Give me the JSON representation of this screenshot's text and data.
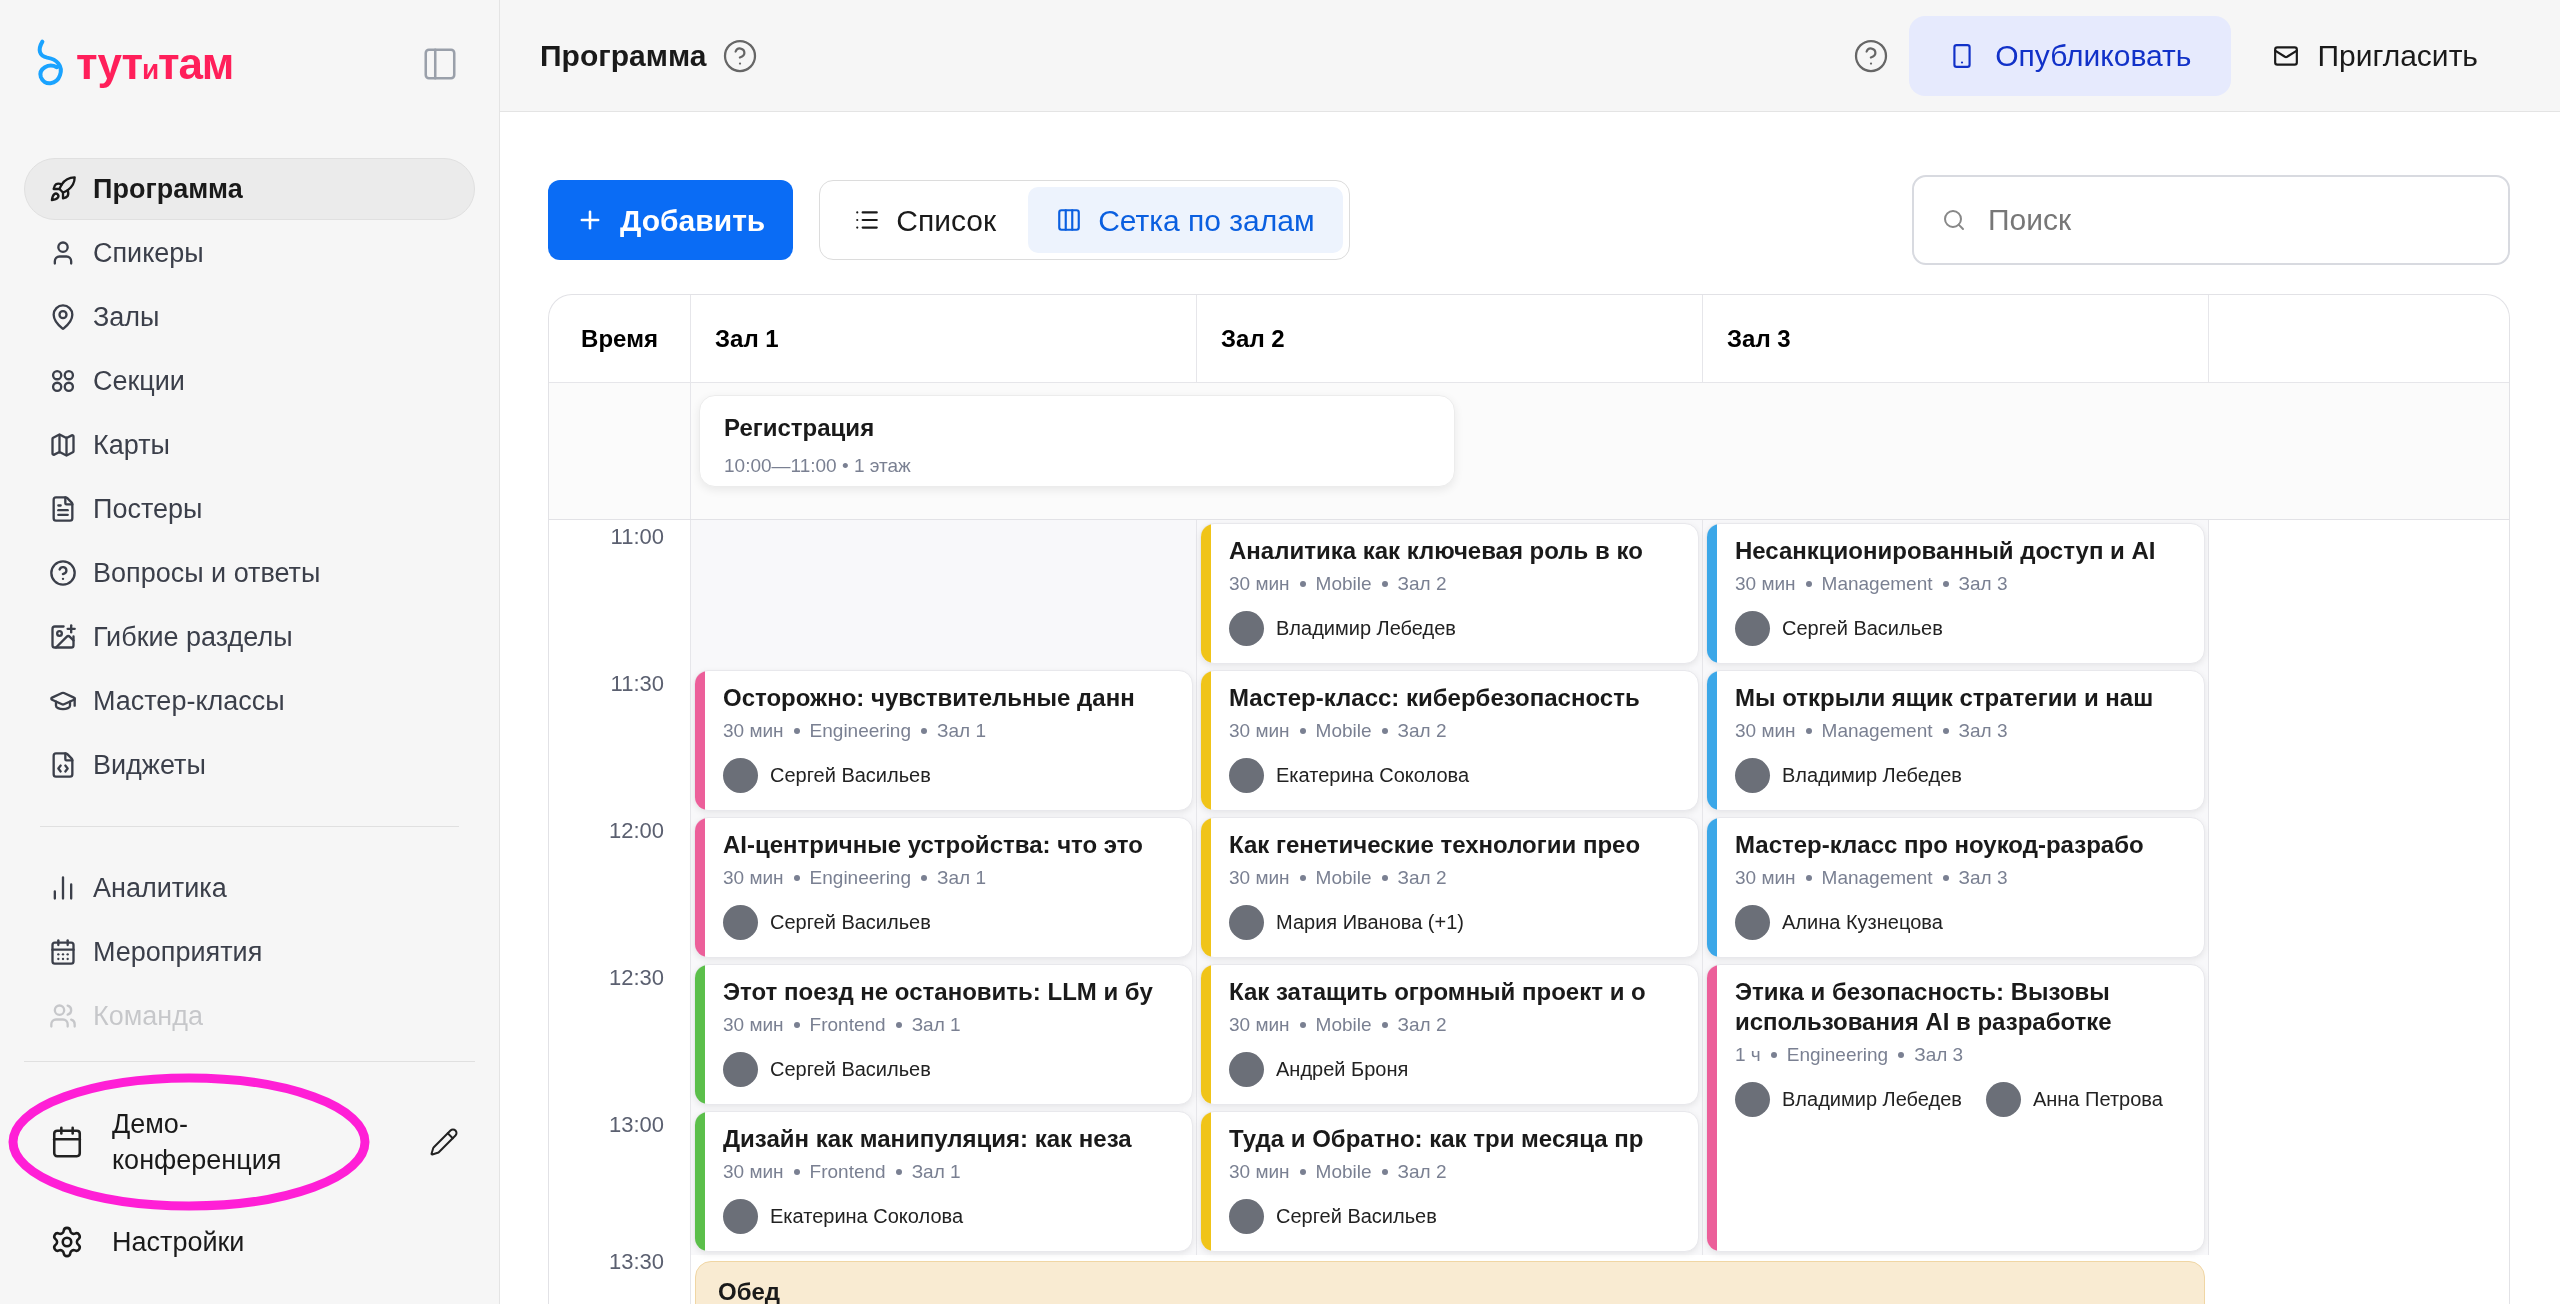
{
  "logo": {
    "part_1": "тут",
    "part_2": "и",
    "part_3": "там"
  },
  "sidebar": {
    "items": [
      {
        "label": "Программа",
        "selected": true,
        "dimmed": false
      },
      {
        "label": "Спикеры",
        "selected": false,
        "dimmed": false
      },
      {
        "label": "Залы",
        "selected": false,
        "dimmed": false
      },
      {
        "label": "Секции",
        "selected": false,
        "dimmed": false
      },
      {
        "label": "Карты",
        "selected": false,
        "dimmed": false
      },
      {
        "label": "Постеры",
        "selected": false,
        "dimmed": false
      },
      {
        "label": "Вопросы и ответы",
        "selected": false,
        "dimmed": false
      },
      {
        "label": "Гибкие разделы",
        "selected": false,
        "dimmed": false
      },
      {
        "label": "Мастер-классы",
        "selected": false,
        "dimmed": false
      },
      {
        "label": "Виджеты",
        "selected": false,
        "dimmed": false
      }
    ],
    "secondary_items": [
      {
        "label": "Аналитика",
        "selected": false,
        "dimmed": false
      },
      {
        "label": "Мероприятия",
        "selected": false,
        "dimmed": false
      },
      {
        "label": "Команда",
        "selected": false,
        "dimmed": true
      }
    ],
    "event": {
      "line_1": "Демо-",
      "line_2": "конференция"
    },
    "settings": "Настройки"
  },
  "header": {
    "title": "Программа",
    "publish": "Опубликовать",
    "invite": "Пригласить"
  },
  "toolbar": {
    "add": "Добавить",
    "views": [
      {
        "label": "Список",
        "selected": false
      },
      {
        "label": "Сетка по залам",
        "selected": true
      }
    ],
    "search": {
      "placeholder": "Поиск"
    }
  },
  "grid": {
    "time_heading": "Время",
    "rooms": [
      "Зал 1",
      "Зал 2",
      "Зал 3"
    ],
    "registration": {
      "title": "Регистрация",
      "details": "10:00—11:00 • 1 этаж"
    },
    "times": [
      "11:00",
      "11:30",
      "12:00",
      "12:30",
      "13:00"
    ],
    "lunch": {
      "time": "13:30",
      "title": "Обед"
    },
    "columns": [
      [
        {
          "kind": "empty"
        },
        {
          "kind": "half_hour",
          "color": "#ec5f9a",
          "title": "Осторожно: чувствительные данн",
          "duration": "30 мин",
          "track": "Engineering",
          "room": "Зал 1",
          "speakers": [
            "Сергей Васильев"
          ]
        },
        {
          "kind": "half_hour",
          "color": "#ec5f9a",
          "title": "AI-центричные устройства: что это",
          "duration": "30 мин",
          "track": "Engineering",
          "room": "Зал 1",
          "speakers": [
            "Сергей Васильев"
          ]
        },
        {
          "kind": "half_hour",
          "color": "#5bbf4a",
          "title": "Этот поезд не остановить: LLM и бу",
          "duration": "30 мин",
          "track": "Frontend",
          "room": "Зал 1",
          "speakers": [
            "Сергей Васильев"
          ]
        },
        {
          "kind": "half_hour",
          "color": "#5bbf4a",
          "title": "Дизайн как манипуляция: как неза",
          "duration": "30 мин",
          "track": "Frontend",
          "room": "Зал 1",
          "speakers": [
            "Екатерина Соколова"
          ]
        }
      ],
      [
        {
          "kind": "half_hour",
          "color": "#f0c419",
          "title": "Аналитика как ключевая роль в ко",
          "duration": "30 мин",
          "track": "Mobile",
          "room": "Зал 2",
          "speakers": [
            "Владимир Лебедев"
          ]
        },
        {
          "kind": "half_hour",
          "color": "#f0c419",
          "title": "Мастер-класс: кибербезопасность",
          "duration": "30 мин",
          "track": "Mobile",
          "room": "Зал 2",
          "speakers": [
            "Екатерина Соколова"
          ]
        },
        {
          "kind": "half_hour",
          "color": "#f0c419",
          "title": "Как генетические технологии прео",
          "duration": "30 мин",
          "track": "Mobile",
          "room": "Зал 2",
          "speakers": [
            "Мария Иванова (+1)"
          ]
        },
        {
          "kind": "half_hour",
          "color": "#f0c419",
          "title": "Как затащить огромный проект и о",
          "duration": "30 мин",
          "track": "Mobile",
          "room": "Зал 2",
          "speakers": [
            "Андрей Броня"
          ]
        },
        {
          "kind": "half_hour",
          "color": "#f0c419",
          "title": "Туда и Обратно: как три месяца пр",
          "duration": "30 мин",
          "track": "Mobile",
          "room": "Зал 2",
          "speakers": [
            "Сергей Васильев"
          ]
        }
      ],
      [
        {
          "kind": "half_hour",
          "color": "#3ba7e8",
          "title": "Несанкционированный доступ и AI",
          "duration": "30 мин",
          "track": "Management",
          "room": "Зал 3",
          "speakers": [
            "Сергей Васильев"
          ]
        },
        {
          "kind": "half_hour",
          "color": "#3ba7e8",
          "title": "Мы открыли ящик стратегии и наш",
          "duration": "30 мин",
          "track": "Management",
          "room": "Зал 3",
          "speakers": [
            "Владимир Лебедев"
          ]
        },
        {
          "kind": "half_hour",
          "color": "#3ba7e8",
          "title": "Мастер-класс про ноукод-разрабо",
          "duration": "30 мин",
          "track": "Management",
          "room": "Зал 3",
          "speakers": [
            "Алина Кузнецова"
          ]
        },
        {
          "kind": "hour",
          "color": "#ec5f9a",
          "title": "Этика и безопасность: Вызовы использования AI в разработке",
          "duration": "1 ч",
          "track": "Engineering",
          "room": "Зал 3",
          "speakers": [
            "Владимир Лебедев",
            "Анна Петрова"
          ]
        }
      ]
    ]
  }
}
